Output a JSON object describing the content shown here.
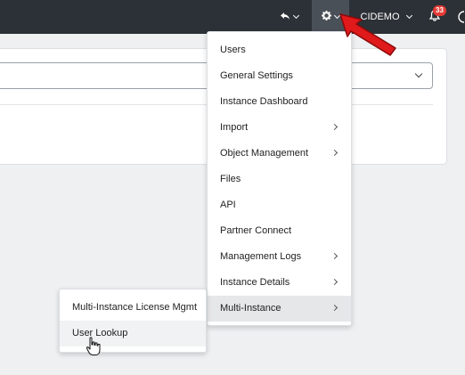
{
  "topbar": {
    "user_label": "CIDEMO",
    "notification_count": "33",
    "back_icon": "undo-arrow-icon",
    "settings_icon": "gear-icon",
    "bell_icon": "bell-icon",
    "colors": {
      "background": "#2c3137",
      "active": "#4a5058",
      "badge": "#e53935"
    }
  },
  "settings_menu": {
    "items": [
      {
        "label": "Users"
      },
      {
        "label": "General Settings"
      },
      {
        "label": "Instance Dashboard"
      },
      {
        "label": "Import",
        "has_submenu": true
      },
      {
        "label": "Object Management",
        "has_submenu": true
      },
      {
        "label": "Files"
      },
      {
        "label": "API"
      },
      {
        "label": "Partner Connect"
      },
      {
        "label": "Management Logs",
        "has_submenu": true
      },
      {
        "label": "Instance Details",
        "has_submenu": true
      },
      {
        "label": "Multi-Instance",
        "has_submenu": true,
        "active": true
      }
    ]
  },
  "multi_instance_submenu": {
    "items": [
      {
        "label": "Multi-Instance License Mgmt"
      },
      {
        "label": "User Lookup",
        "hovered": true
      }
    ]
  },
  "annotation": {
    "color": "#e0191b",
    "icon": "red-pointer-arrow-icon"
  }
}
